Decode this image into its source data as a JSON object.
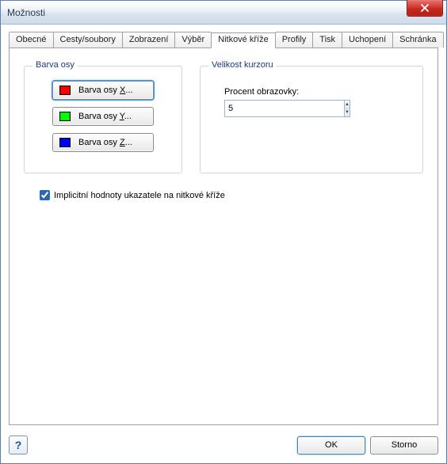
{
  "window": {
    "title": "Možnosti"
  },
  "tabs": {
    "obecne": "Obecné",
    "cesty": "Cesty/soubory",
    "zobrazeni": "Zobrazení",
    "vyber": "Výběr",
    "nitkove": "Nitkové kříže",
    "profily": "Profily",
    "tisk": "Tisk",
    "uchopeni": "Uchopení",
    "schranka": "Schránka",
    "active": "nitkove"
  },
  "group_axis": {
    "legend": "Barva osy",
    "btn_x_prefix": "Barva osy ",
    "btn_x_letter": "X",
    "btn_x_suffix": "...",
    "btn_y_prefix": "Barva osy ",
    "btn_y_letter": "Y",
    "btn_y_suffix": "...",
    "btn_z_prefix": "Barva osy ",
    "btn_z_letter": "Z",
    "btn_z_suffix": "..."
  },
  "group_cursor": {
    "legend": "Velikost kurzoru",
    "label": "Procent obrazovky:",
    "value": "5"
  },
  "checkbox": {
    "label": "Implicitní hodnoty ukazatele na nitkové kříže",
    "checked": true
  },
  "footer": {
    "help": "?",
    "ok": "OK",
    "cancel": "Storno"
  }
}
